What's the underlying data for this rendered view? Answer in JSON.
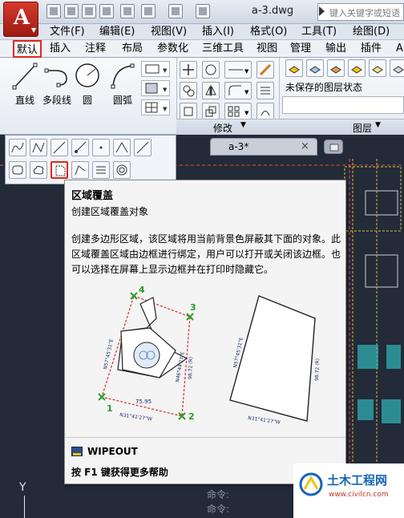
{
  "app": {
    "doc_title": "a-3.dwg",
    "search_placeholder": "键入关键字或短语"
  },
  "menu": [
    "文件(F)",
    "编辑(E)",
    "视图(V)",
    "插入(I)",
    "格式(O)",
    "工具(T)",
    "绘图(D)"
  ],
  "ribbon_tabs": [
    "默认",
    "插入",
    "注释",
    "布局",
    "参数化",
    "三维工具",
    "视图",
    "管理",
    "输出",
    "插件",
    "A"
  ],
  "draw_tools": [
    "直线",
    "多段线",
    "圆",
    "圆弧"
  ],
  "layer_state": "未保存的图层状态",
  "panels": {
    "modify": "修改",
    "layer": "图层"
  },
  "doc_tab": {
    "label": "a-3*",
    "close": "×"
  },
  "tooltip": {
    "title": "区域覆盖",
    "subtitle": "创建区域覆盖对象",
    "body": "创建多边形区域，该区域将用当前背景色屏蔽其下面的对象。此区域覆盖区域由边框进行绑定，用户可以打开或关闭该边框。也可以选择在屏幕上显示边框并在打印时隐藏它。",
    "command": "WIPEOUT",
    "help": "按 F1 键获得更多帮助"
  },
  "figure": {
    "vertex_numbers": [
      "1",
      "2",
      "3",
      "4"
    ],
    "left_dims": [
      "N57°45'31\"E",
      "N46°44'23\"E",
      "98.72 (R)",
      "75.95",
      "N31°41'27\"W"
    ],
    "right_dims": [
      "N57°45'31\"E",
      "98.72 (R)",
      "N31°41'27\"W"
    ]
  },
  "command_line": [
    "命令:",
    "命令:"
  ],
  "ucs": "Y",
  "watermark": {
    "title": "土木工程网",
    "url": "www.civilcn.com"
  },
  "colors": {
    "highlight_red": "#e0281c",
    "canvas_bg": "#232a38",
    "app_red": "#c0281c"
  }
}
